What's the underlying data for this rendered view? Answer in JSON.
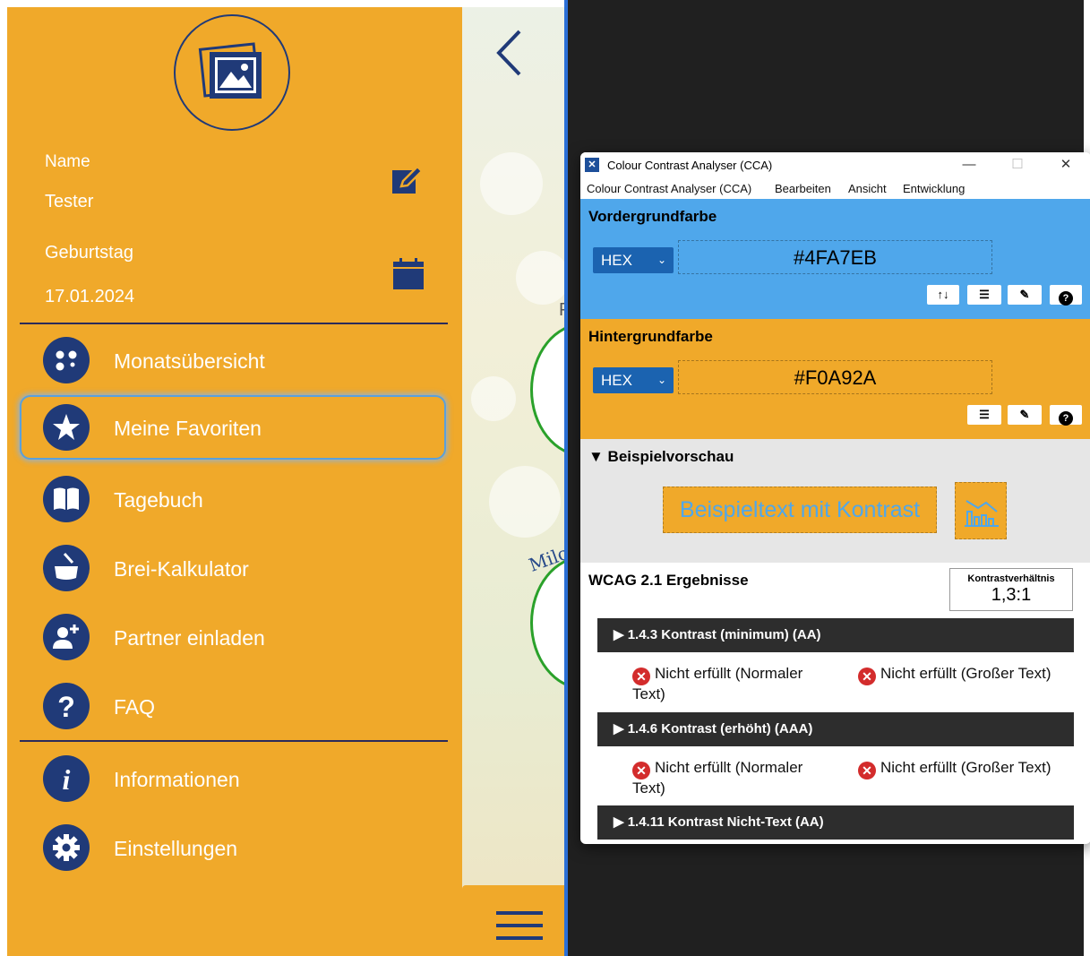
{
  "app": {
    "profile": {
      "name_label": "Name",
      "name_value": "Tester",
      "birthday_label": "Geburtstag",
      "birthday_value": "17.01.2024"
    },
    "menu": [
      {
        "label": "Monatsübersicht",
        "icon": "dots-icon"
      },
      {
        "label": "Meine Favoriten",
        "icon": "star-icon",
        "active": true
      },
      {
        "label": "Tagebuch",
        "icon": "book-icon"
      },
      {
        "label": "Brei-Kalkulator",
        "icon": "pot-icon"
      },
      {
        "label": "Partner einladen",
        "icon": "add-user-icon"
      },
      {
        "label": "FAQ",
        "icon": "question-icon"
      },
      {
        "label": "Informationen",
        "icon": "info-icon"
      },
      {
        "label": "Einstellungen",
        "icon": "gear-icon"
      }
    ],
    "colors": {
      "sidebar": "#F0A92A",
      "icon_navy": "#203a78"
    },
    "peek_text_1": "P",
    "peek_text_2": "Milc"
  },
  "cca": {
    "title": "Colour Contrast Analyser (CCA)",
    "window_buttons": {
      "minimize": "—",
      "maximize": "☐",
      "close": "✕"
    },
    "menu": [
      "Colour Contrast Analyser (CCA)",
      "Bearbeiten",
      "Ansicht",
      "Entwicklung"
    ],
    "foreground": {
      "heading": "Vordergrundfarbe",
      "format": "HEX",
      "value": "#4FA7EB",
      "color": "#4FA7EB"
    },
    "background": {
      "heading": "Hintergrundfarbe",
      "format": "HEX",
      "value": "#F0A92A",
      "color": "#F0A92A"
    },
    "tool_icons": {
      "swap": "swap-icon",
      "sliders": "sliders-icon",
      "picker": "eyedropper-icon",
      "help": "help-icon"
    },
    "preview": {
      "heading": "▼ Beispielvorschau",
      "sample_text": "Beispieltext mit Kontrast"
    },
    "results": {
      "heading": "WCAG 2.1 Ergebnisse",
      "ratio_label": "Kontrastverhältnis",
      "ratio_value": "1,3:1",
      "criteria": [
        {
          "label": "▶ 1.4.3 Kontrast (minimum) (AA)",
          "normal": "Nicht erfüllt (Normaler Text)",
          "large": "Nicht erfüllt (Großer Text)"
        },
        {
          "label": "▶ 1.4.6 Kontrast (erhöht) (AAA)",
          "normal": "Nicht erfüllt (Normaler Text)",
          "large": "Nicht erfüllt (Großer Text)"
        },
        {
          "label": "▶ 1.4.11 Kontrast Nicht-Text (AA)"
        }
      ]
    }
  }
}
